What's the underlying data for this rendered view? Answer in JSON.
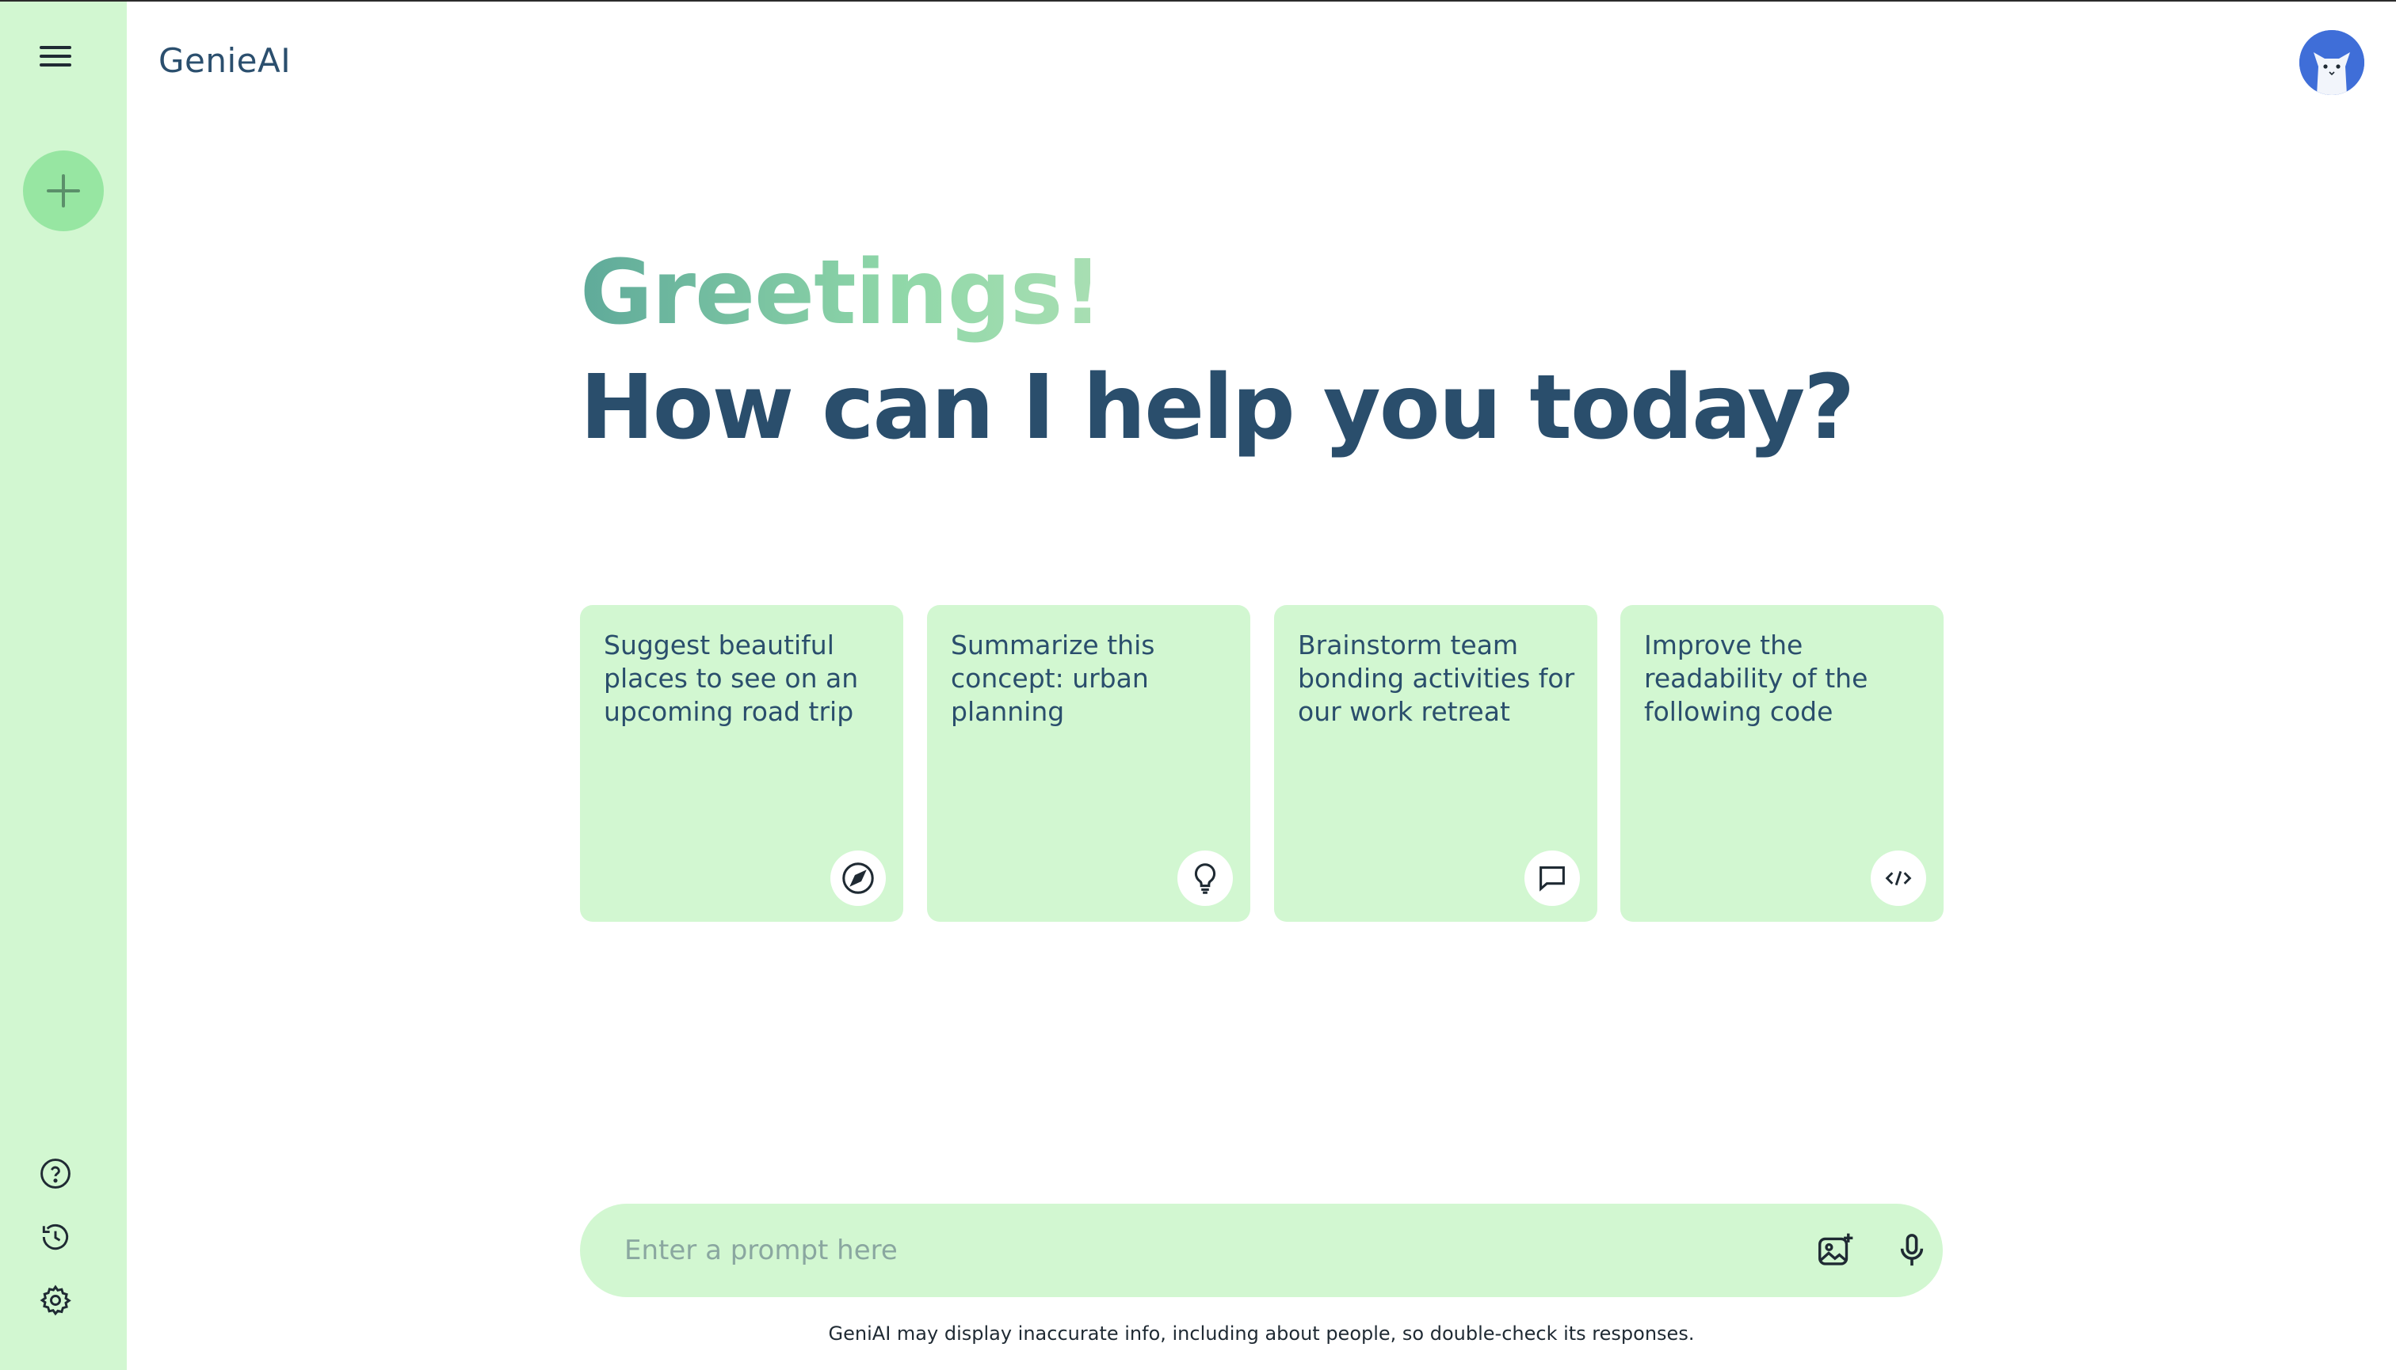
{
  "app": {
    "title": "GenieAI"
  },
  "sidebar": {
    "menu_icon": "hamburger-menu-icon",
    "new_chat_icon": "plus-icon",
    "bottom_icons": [
      "help-icon",
      "history-icon",
      "settings-icon"
    ]
  },
  "greeting": {
    "line1": "Greetings!",
    "line2": "How can I help you today?"
  },
  "cards": [
    {
      "text": "Suggest beautiful places to see on an upcoming road trip",
      "icon": "compass-icon"
    },
    {
      "text": "Summarize this concept: urban planning",
      "icon": "lightbulb-icon"
    },
    {
      "text": "Brainstorm team bonding activities for our work retreat",
      "icon": "chat-bubble-icon"
    },
    {
      "text": "Improve the readability of the following code",
      "icon": "code-icon"
    }
  ],
  "prompt": {
    "placeholder": "Enter a prompt here",
    "value": "",
    "image_icon": "add-image-icon",
    "mic_icon": "microphone-icon"
  },
  "disclaimer": "GeniAI may display inaccurate info, including about people, so double-check its responses.",
  "colors": {
    "sidebar_bg": "#d2f7d1",
    "accent_green": "#97e6a2",
    "heading_blue": "#2a4e6c"
  }
}
